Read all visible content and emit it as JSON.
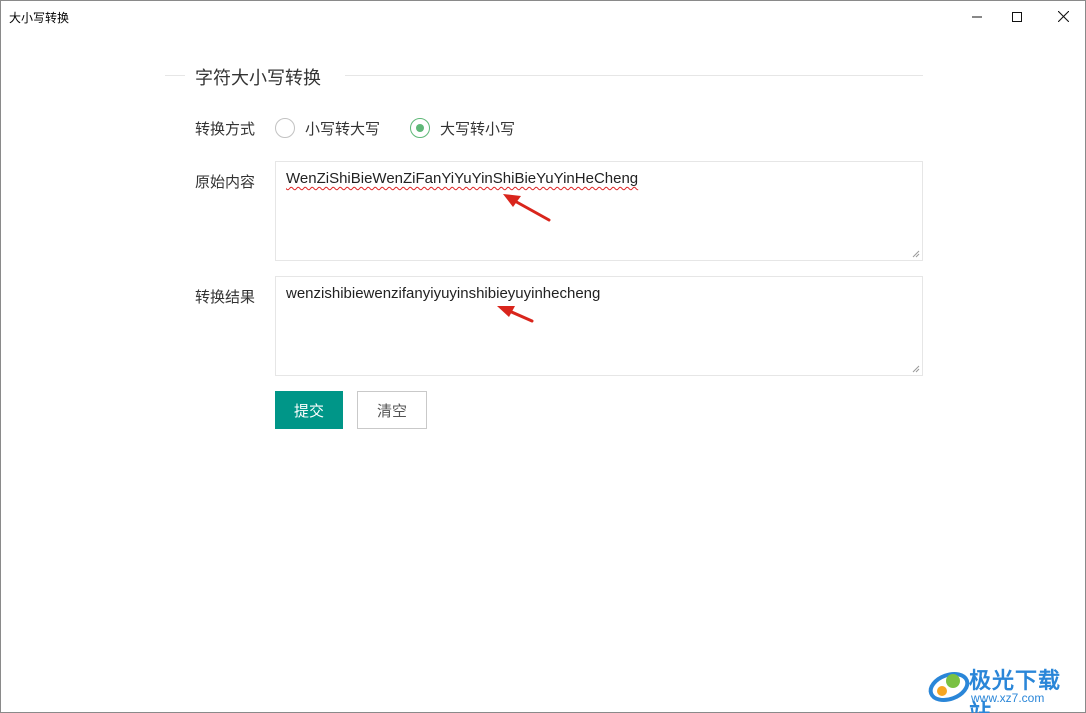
{
  "window": {
    "title": "大小写转换",
    "controls": {
      "minimize": "minimize-icon",
      "maximize": "maximize-icon",
      "close": "close-icon"
    }
  },
  "form": {
    "legend": "字符大小写转换",
    "mode": {
      "label": "转换方式",
      "options": [
        {
          "label": "小写转大写",
          "checked": false
        },
        {
          "label": "大写转小写",
          "checked": true
        }
      ]
    },
    "source": {
      "label": "原始内容",
      "value": "WenZiShiBieWenZiFanYiYuYinShiBieYuYinHeCheng"
    },
    "result": {
      "label": "转换结果",
      "value": "wenzishibiewenzifanyiyuyinshibieyuyinhecheng"
    },
    "buttons": {
      "submit": "提交",
      "clear": "清空"
    }
  },
  "colors": {
    "primary": "#009688",
    "radio_checked": "#5fb878",
    "annotation_arrow": "#d9251c",
    "watermark": "#2a86d8"
  },
  "watermark": {
    "title": "极光下载站",
    "url": "www.xz7.com"
  }
}
